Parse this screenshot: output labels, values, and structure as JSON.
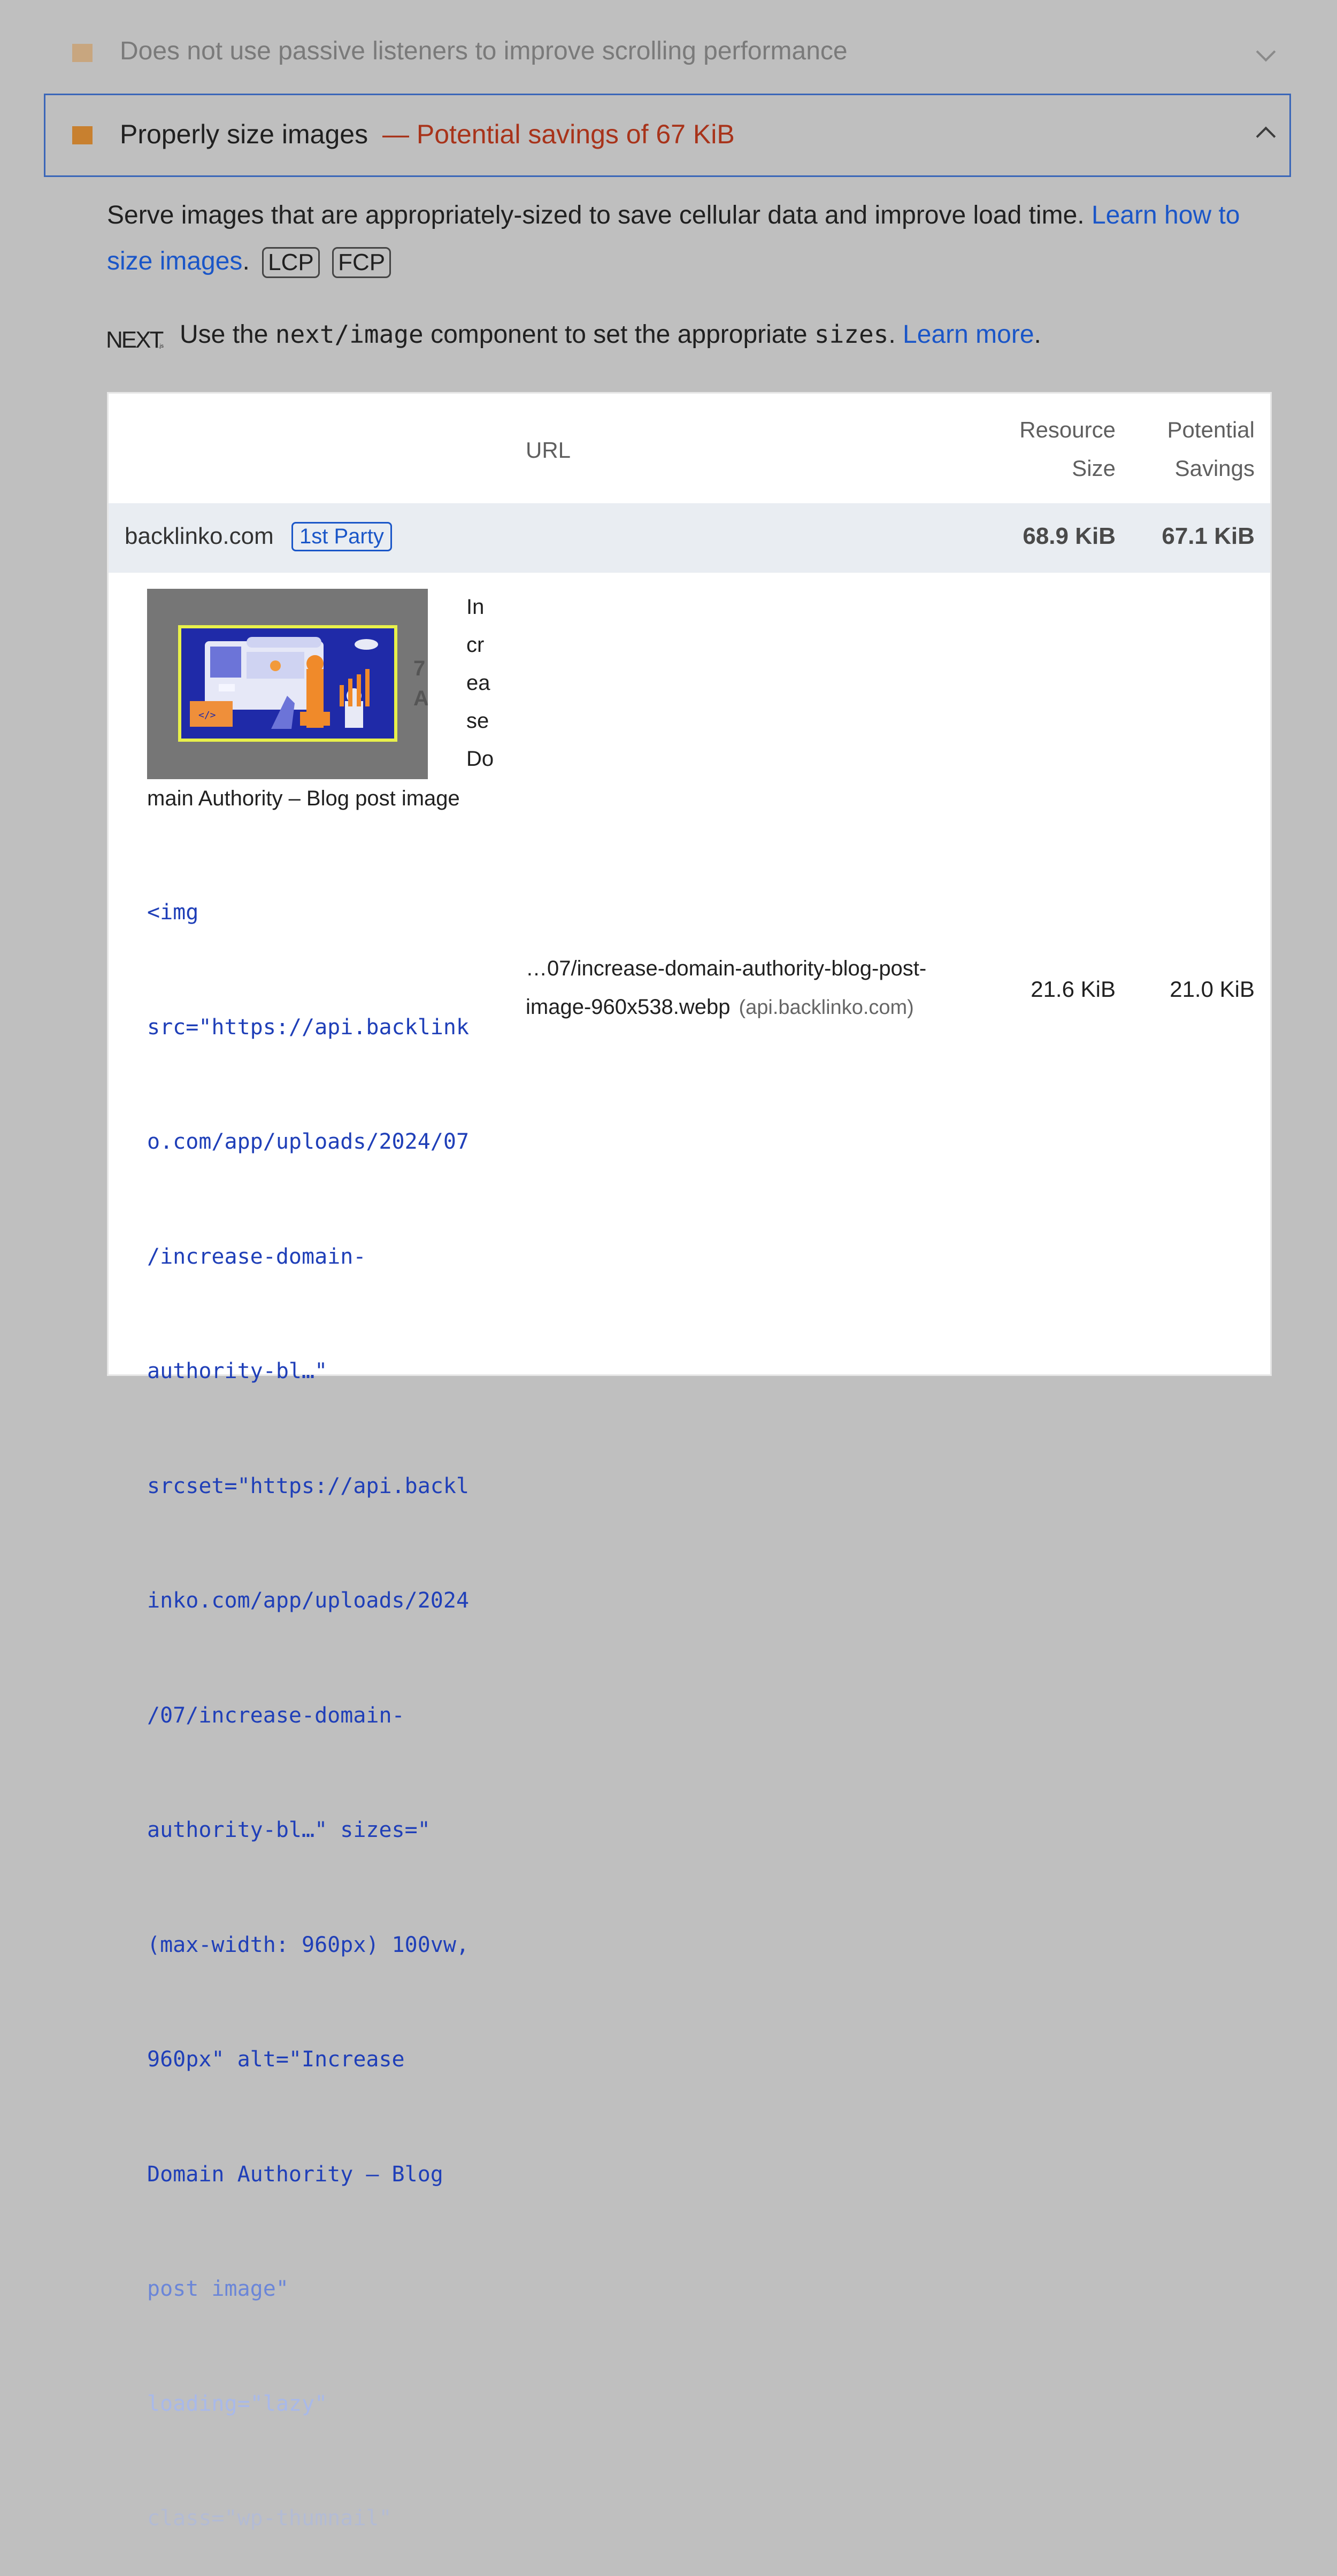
{
  "audits": {
    "collapsed": {
      "title": "Does not use passive listeners to improve scrolling performance",
      "color": "#c8a67f"
    },
    "expanded": {
      "title": "Properly size images",
      "savings": "— Potential savings of 67 KiB",
      "color": "#c8802f",
      "description": "Serve images that are appropriately-sized to save cellular data and improve load time.",
      "learn_link": "Learn how to size images",
      "metric_chips": [
        "LCP",
        "FCP"
      ],
      "stack_pack": {
        "logo": "NEXT.js",
        "text_before": "Use the",
        "code_1": "next/image",
        "text_middle": "component to set the appropriate",
        "code_2": "sizes",
        "link": "Learn more"
      }
    }
  },
  "table": {
    "headers": {
      "url": "URL",
      "resource_size": [
        "Resource",
        "Size"
      ],
      "potential_savings": [
        "Potential",
        "Savings"
      ]
    },
    "group": {
      "name": "backlinko.com",
      "badge": "1st Party",
      "resource_size": "68.9 KiB",
      "potential_savings": "67.1 KiB"
    },
    "rows": [
      {
        "element_alt_wrapped": [
          "In",
          "cr",
          "ea",
          "se",
          "Do"
        ],
        "element_alt_tail": "main Authority – Blog post image",
        "snippet": [
          "<img",
          "src=\"https://api.backlink",
          "o.com/app/uploads/2024/07",
          "/increase-domain-",
          "authority-bl…\"",
          "srcset=\"https://api.backl",
          "inko.com/app/uploads/2024",
          "/07/increase-domain-",
          "authority-bl…\" sizes=\"",
          "(max-width: 960px) 100vw,",
          "960px\" alt=\"Increase",
          "Domain Authority – Blog",
          "post image\"",
          "loading=\"lazy\"",
          "class=\"wp-thumnail\""
        ],
        "url": "…07/increase-domain-authority-blog-post-image-960x538.webp",
        "url_line1": "…07/increase-domain-authority-blog-post-",
        "url_line2": "image-960x538.webp",
        "host": "(api.backlinko.com)",
        "resource_size": "21.6 KiB",
        "potential_savings": "21.0 KiB"
      }
    ]
  }
}
